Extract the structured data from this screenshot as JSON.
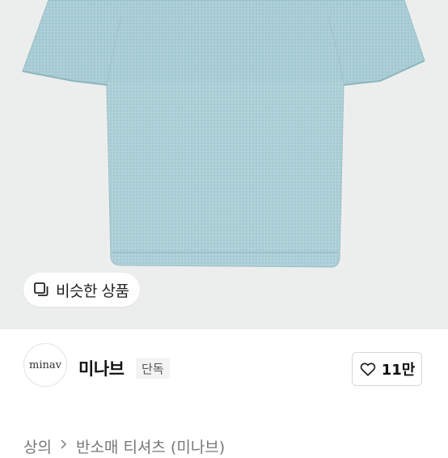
{
  "hero": {
    "image_alt": "light blue knit short sleeve t-shirt",
    "background_color": "#eceeed",
    "product_color": "#a7cbd3",
    "similar_button": {
      "icon": "copy-icon",
      "label": "비슷한 상품"
    }
  },
  "seller": {
    "avatar_text": "minav",
    "brand_name": "미나브",
    "badge": "단독",
    "like": {
      "icon": "heart-outline-icon",
      "count": "11만"
    }
  },
  "breadcrumb": {
    "category": "상의",
    "separator_icon": "chevron-right-icon",
    "subcategory": "반소매 티셔츠 (미나브)"
  }
}
